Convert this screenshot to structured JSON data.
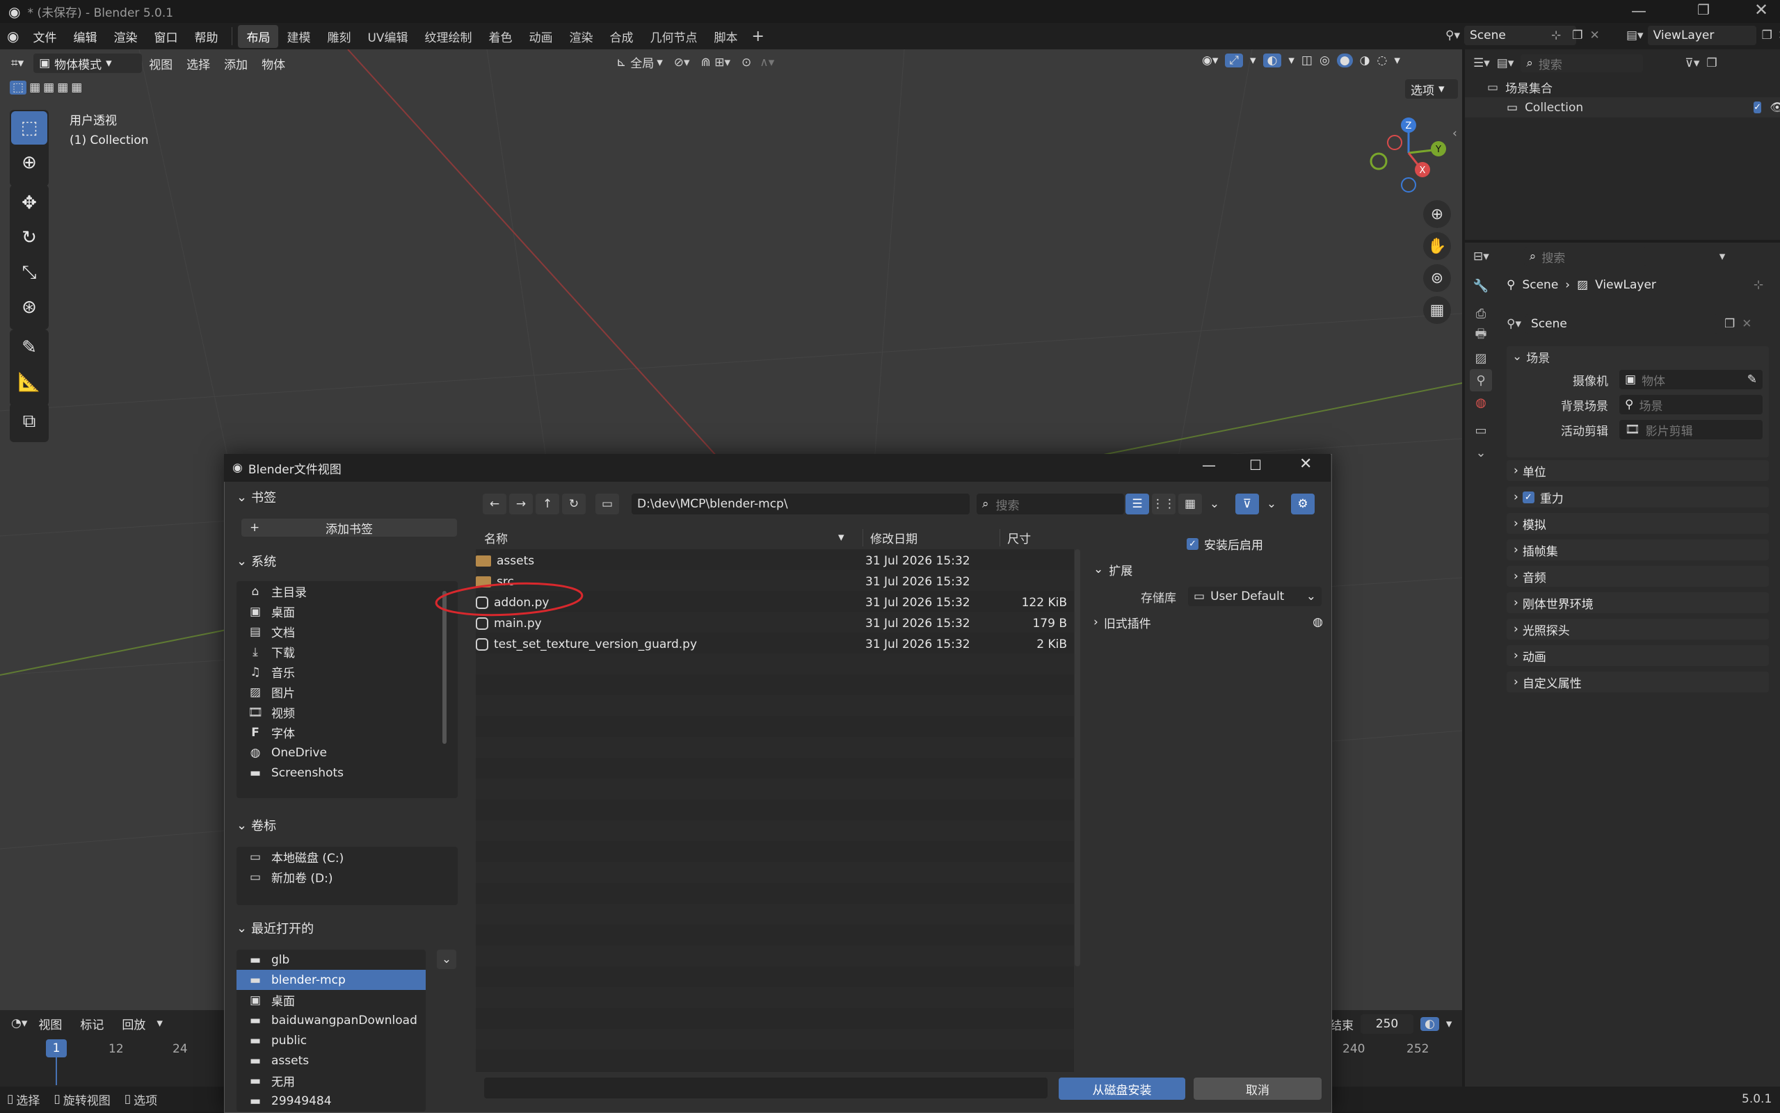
{
  "window": {
    "title": "* (未保存) - Blender 5.0.1"
  },
  "menu": [
    "文件",
    "编辑",
    "渲染",
    "窗口",
    "帮助"
  ],
  "workspaces": [
    "布局",
    "建模",
    "雕刻",
    "UV编辑",
    "纹理绘制",
    "着色",
    "动画",
    "渲染",
    "合成",
    "几何节点",
    "脚本"
  ],
  "topright": {
    "scene": "Scene",
    "view_layer": "ViewLayer"
  },
  "viewport": {
    "mode": "物体模式",
    "menus": [
      "视图",
      "选择",
      "添加",
      "物体"
    ],
    "transform": "全局",
    "options": "选项",
    "overlay_line1": "用户透视",
    "overlay_line2": "(1) Collection",
    "gizmo": {
      "x": "X",
      "y": "Y",
      "z": "Z"
    }
  },
  "outliner": {
    "search_placeholder": "搜索",
    "scene_collection": "场景集合",
    "collection": "Collection"
  },
  "properties": {
    "search_placeholder": "搜索",
    "breadcrumb_scene": "Scene",
    "breadcrumb_layer": "ViewLayer",
    "scene_name": "Scene",
    "section_scene": "场景",
    "camera_label": "摄像机",
    "camera_placeholder": "物体",
    "bg_label": "背景场景",
    "bg_placeholder": "场景",
    "clip_label": "活动剪辑",
    "clip_placeholder": "影片剪辑",
    "panels": [
      "单位",
      "重力",
      "模拟",
      "插帧集",
      "音频",
      "刚体世界环境",
      "光照探头",
      "动画",
      "自定义属性"
    ]
  },
  "timeline": {
    "menus": [
      "视图",
      "标记",
      "回放"
    ],
    "end_label": "结束",
    "end_value": "250",
    "current_frame": "1",
    "ticks_left": [
      "12",
      "24"
    ],
    "ticks_right": [
      "240",
      "252"
    ]
  },
  "statusbar": {
    "select": "选择",
    "rotate": "旋转视图",
    "options": "选项",
    "version": "5.0.1"
  },
  "dialog": {
    "title": "Blender文件视图",
    "path": "D:\\dev\\MCP\\blender-mcp\\",
    "search_placeholder": "搜索",
    "bookmarks": {
      "title": "书签",
      "add": "添加书签"
    },
    "system": {
      "title": "系统",
      "items": [
        "主目录",
        "桌面",
        "文档",
        "下载",
        "音乐",
        "图片",
        "视频",
        "字体",
        "OneDrive",
        "Screenshots"
      ]
    },
    "volumes": {
      "title": "卷标",
      "items": [
        "本地磁盘 (C:)",
        "新加卷 (D:)"
      ]
    },
    "recent": {
      "title": "最近打开的",
      "items": [
        "glb",
        "blender-mcp",
        "桌面",
        "baiduwangpanDownload",
        "public",
        "assets",
        "无用",
        "29949484"
      ]
    },
    "columns": {
      "name": "名称",
      "date": "修改日期",
      "size": "尺寸"
    },
    "files": [
      {
        "name": "assets",
        "date": "31 Jul 2026 15:32",
        "size": "",
        "type": "folder"
      },
      {
        "name": "src",
        "date": "31 Jul 2026 15:32",
        "size": "",
        "type": "folder"
      },
      {
        "name": "addon.py",
        "date": "31 Jul 2026 15:32",
        "size": "122 KiB",
        "type": "py"
      },
      {
        "name": "main.py",
        "date": "31 Jul 2026 15:32",
        "size": "179 B",
        "type": "py"
      },
      {
        "name": "test_set_texture_version_guard.py",
        "date": "31 Jul 2026 15:32",
        "size": "2 KiB",
        "type": "py"
      }
    ],
    "options": {
      "enable_after_install": "安装后启用",
      "extensions": "扩展",
      "repo_label": "存储库",
      "repo_value": "User Default",
      "legacy": "旧式插件"
    },
    "install_button": "从磁盘安装",
    "cancel_button": "取消"
  },
  "colors": {
    "accent": "#4772b3",
    "annotation": "#d8282d"
  }
}
